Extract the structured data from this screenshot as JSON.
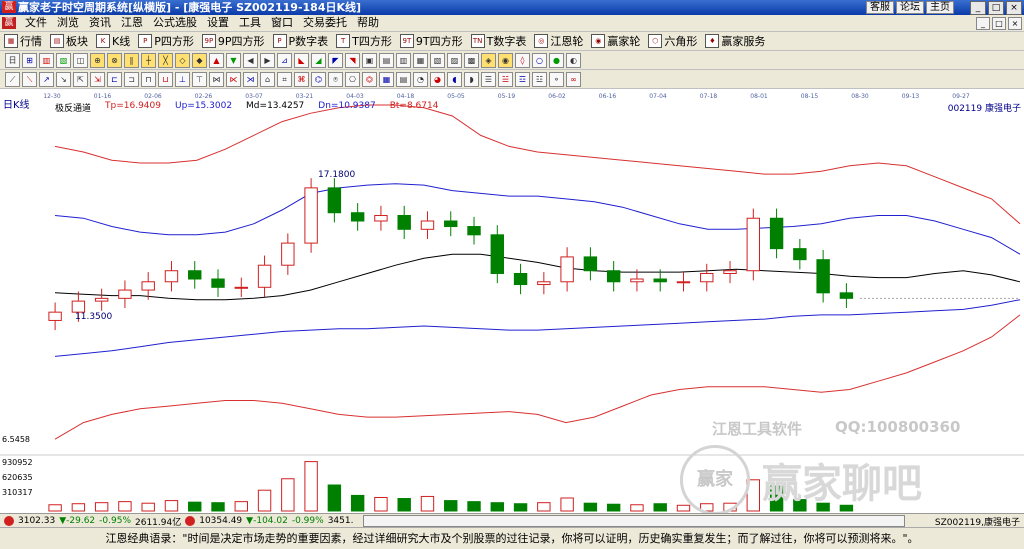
{
  "window": {
    "logo": "赢",
    "title": "赢家老子时空周期系统[纵横版] - [康强电子  SZ002119-184日K线]",
    "links": [
      "客服",
      "论坛",
      "主页"
    ],
    "controls": [
      "_",
      "□",
      "×"
    ]
  },
  "menu": {
    "items": [
      "文件",
      "浏览",
      "资讯",
      "江恩",
      "公式选股",
      "设置",
      "工具",
      "窗口",
      "交易委托",
      "帮助"
    ],
    "mdi_controls": [
      "_",
      "□",
      "×"
    ]
  },
  "toolbar1": {
    "items": [
      "行情",
      "板块",
      "K线",
      "P四方形",
      "9P四方形",
      "P数字表",
      "T四方形",
      "9T四方形",
      "T数字表",
      "江恩轮",
      "赢家轮",
      "六角形",
      "赢家服务"
    ]
  },
  "chart": {
    "period_label": "日K线",
    "indicator_name": "极反通道",
    "tp": "Tp=16.9409",
    "up": "Up=15.3002",
    "md": "Md=13.4257",
    "dn": "Dn=10.9387",
    "bt": "Bt=8.6714",
    "stock_code": "002119",
    "stock_name": "康强电子",
    "date_ticks": [
      "12-30",
      "01-16",
      "02-06",
      "02-26",
      "03-07",
      "03-21",
      "04-03",
      "04-18",
      "05-05",
      "05-19",
      "06-02",
      "06-16",
      "07-04",
      "07-18",
      "08-01",
      "08-15",
      "08-30",
      "09-13",
      "09-27"
    ],
    "high_label": "17.1800",
    "low_label": "11.3500",
    "volume_axis": [
      "6.5458",
      "930952",
      "620635",
      "310317"
    ]
  },
  "watermark": {
    "company": "江恩工具软件",
    "qq": "QQ:100800360",
    "brand": "赢家聊吧",
    "seal": "赢家"
  },
  "status": {
    "sh_index": "3102.33",
    "sh_change": "▼-29.62",
    "sh_pct": "-0.95%",
    "sh_amount": "2611.94亿",
    "sz_index": "10354.49",
    "sz_change": "▼-104.02",
    "sz_pct": "-0.99%",
    "sz_amount": "3451.",
    "right": "SZ002119,康强电子"
  },
  "quote": "江恩经典语录：\"时间是决定市场走势的重要因素，经过详细研究大市及个别股票的过往记录，你将可以证明，历史确实重复发生；而了解过往，你将可以预测将来。\"。",
  "colors": {
    "outer_band": "#d83030",
    "inner_band": "#2020d0",
    "mid_line": "#000000",
    "up_candle": "#d02020",
    "down_candle": "#008000",
    "title_bar": "#0a3aa8"
  },
  "chart_data": {
    "type": "candlestick",
    "price_range": [
      6.5458,
      19.0
    ],
    "mid": [
      12.2,
      12.15,
      12.1,
      12.1,
      12.0,
      11.95,
      11.95,
      12.0,
      12.1,
      12.3,
      12.6,
      12.9,
      13.2,
      13.45,
      13.6,
      13.6,
      13.45,
      13.3,
      13.1,
      13.0,
      12.95,
      12.95,
      12.95,
      13.0,
      13.05,
      13.0,
      12.95,
      12.9,
      12.8,
      12.75,
      12.75,
      12.9,
      13.0,
      12.85,
      12.6
    ],
    "inner_upper": [
      15.0,
      14.9,
      14.6,
      14.4,
      14.3,
      14.3,
      14.4,
      14.7,
      15.2,
      15.8,
      16.0,
      16.1,
      16.15,
      16.1,
      15.9,
      15.8,
      15.7,
      15.7,
      15.6,
      15.5,
      15.3,
      15.0,
      14.7,
      14.5,
      14.5,
      14.55,
      14.6,
      14.7,
      14.9,
      15.0,
      15.0,
      14.8,
      14.5,
      14.2,
      13.6
    ],
    "inner_lower": [
      9.9,
      10.0,
      10.1,
      10.25,
      10.4,
      10.5,
      10.6,
      10.7,
      10.8,
      10.85,
      10.9,
      10.9,
      10.95,
      11.0,
      10.95,
      10.9,
      10.85,
      10.85,
      10.9,
      10.95,
      11.0,
      11.05,
      11.1,
      11.15,
      11.2,
      11.25,
      11.35,
      11.4,
      11.4,
      11.45,
      11.5,
      11.55,
      11.6,
      11.75,
      11.95
    ],
    "outer_upper": [
      17.5,
      17.3,
      17.0,
      16.9,
      16.9,
      17.0,
      17.4,
      17.9,
      18.4,
      18.7,
      18.9,
      19.0,
      19.0,
      18.9,
      18.6,
      17.9,
      17.5,
      17.3,
      17.2,
      17.1,
      17.0,
      16.9,
      16.8,
      16.7,
      16.6,
      16.5,
      16.5,
      16.6,
      16.8,
      16.9,
      16.8,
      16.4,
      16.0,
      15.6,
      14.7
    ],
    "outer_lower": [
      6.9,
      7.5,
      7.8,
      8.0,
      8.1,
      8.2,
      8.3,
      8.3,
      8.2,
      8.0,
      7.8,
      7.7,
      7.7,
      7.75,
      7.8,
      7.85,
      7.9,
      7.8,
      7.5,
      7.7,
      8.1,
      8.5,
      8.7,
      8.8,
      8.8,
      8.8,
      8.7,
      8.6,
      8.7,
      9.0,
      9.3,
      9.7,
      10.1,
      10.6,
      11.4
    ],
    "close": [
      11.5,
      11.9,
      12.0,
      12.3,
      12.6,
      13.0,
      12.7,
      12.4,
      12.4,
      13.2,
      14.0,
      16.0,
      15.1,
      14.8,
      15.0,
      14.5,
      14.8,
      14.6,
      14.3,
      12.9,
      12.5,
      12.6,
      13.5,
      13.0,
      12.6,
      12.7,
      12.6,
      12.6,
      12.9,
      13.0,
      14.9,
      13.8,
      13.4,
      12.2,
      12.0
    ],
    "volume": [
      120000,
      140000,
      160000,
      180000,
      150000,
      200000,
      170000,
      160000,
      180000,
      400000,
      620000,
      950000,
      500000,
      300000,
      260000,
      240000,
      280000,
      200000,
      180000,
      160000,
      140000,
      160000,
      250000,
      150000,
      130000,
      120000,
      140000,
      110000,
      140000,
      150000,
      600000,
      480000,
      220000,
      150000,
      110000
    ]
  }
}
